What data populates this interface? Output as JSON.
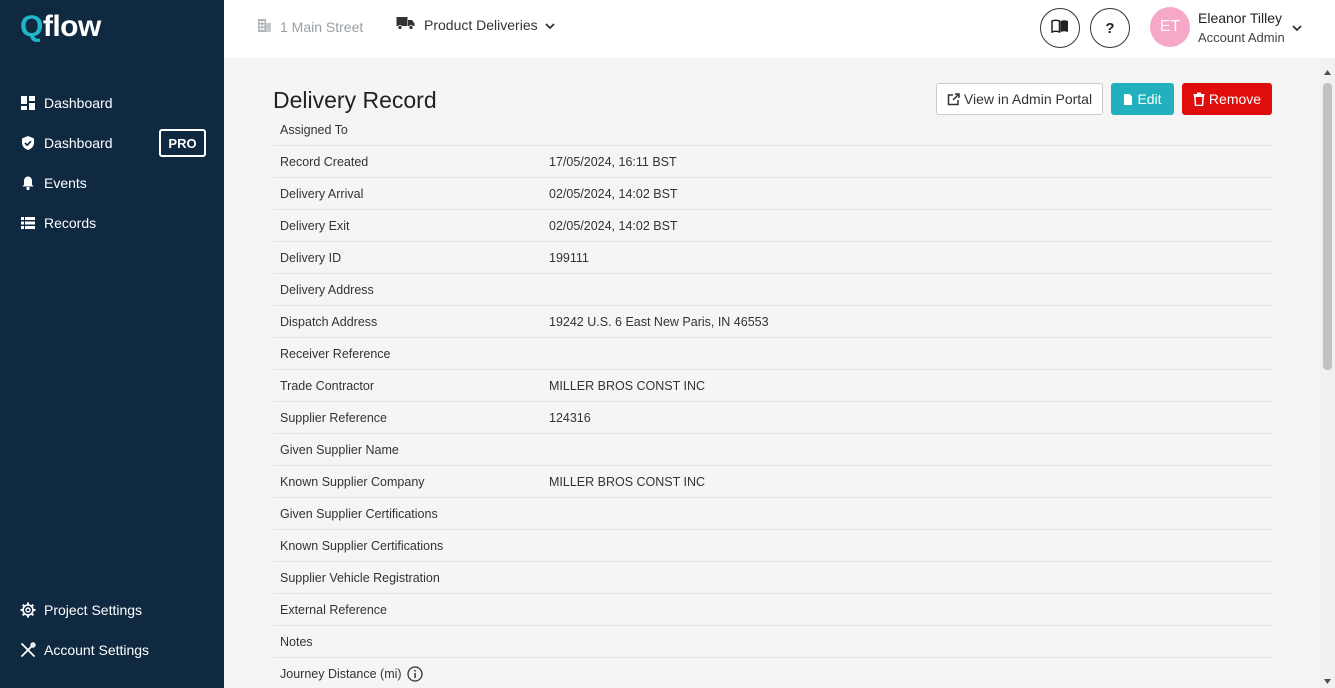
{
  "logo": {
    "q": "Q",
    "rest": "flow"
  },
  "sidebar": {
    "items": [
      {
        "label": "Dashboard",
        "icon": "dashboard-grid-icon"
      },
      {
        "label": "Dashboard",
        "icon": "shield-check-icon",
        "badge": "PRO"
      },
      {
        "label": "Events",
        "icon": "bell-icon"
      },
      {
        "label": "Records",
        "icon": "list-icon"
      }
    ],
    "bottom": [
      {
        "label": "Project Settings",
        "icon": "gear-icon"
      },
      {
        "label": "Account Settings",
        "icon": "tools-icon"
      }
    ]
  },
  "topbar": {
    "site": "1 Main Street",
    "module": "Product Deliveries",
    "help_label": "?",
    "user": {
      "initials": "ET",
      "name": "Eleanor Tilley",
      "role": "Account Admin"
    }
  },
  "record": {
    "title": "Delivery Record",
    "buttons": {
      "portal": "View in Admin Portal",
      "edit": "Edit",
      "remove": "Remove"
    },
    "rows": [
      {
        "label": "Assigned To",
        "value": ""
      },
      {
        "label": "Record Created",
        "value": "17/05/2024, 16:11 BST"
      },
      {
        "label": "Delivery Arrival",
        "value": "02/05/2024, 14:02 BST"
      },
      {
        "label": "Delivery Exit",
        "value": "02/05/2024, 14:02 BST"
      },
      {
        "label": "Delivery ID",
        "value": "199111"
      },
      {
        "label": "Delivery Address",
        "value": ""
      },
      {
        "label": "Dispatch Address",
        "value": "19242 U.S. 6 East New Paris, IN 46553"
      },
      {
        "label": "Receiver Reference",
        "value": ""
      },
      {
        "label": "Trade Contractor",
        "value": "MILLER BROS CONST INC"
      },
      {
        "label": "Supplier Reference",
        "value": "124316"
      },
      {
        "label": "Given Supplier Name",
        "value": ""
      },
      {
        "label": "Known Supplier Company",
        "value": "MILLER BROS CONST INC"
      },
      {
        "label": "Given Supplier Certifications",
        "value": ""
      },
      {
        "label": "Known Supplier Certifications",
        "value": ""
      },
      {
        "label": "Supplier Vehicle Registration",
        "value": ""
      },
      {
        "label": "External Reference",
        "value": ""
      },
      {
        "label": "Notes",
        "value": ""
      },
      {
        "label": "Journey Distance (mi)",
        "value": "",
        "info": true
      }
    ]
  },
  "colors": {
    "sidebar": "#0f2941",
    "accent": "#1fb6c8",
    "edit": "#22b0bf",
    "remove": "#e00d0d",
    "avatar": "#f7a8c9"
  }
}
